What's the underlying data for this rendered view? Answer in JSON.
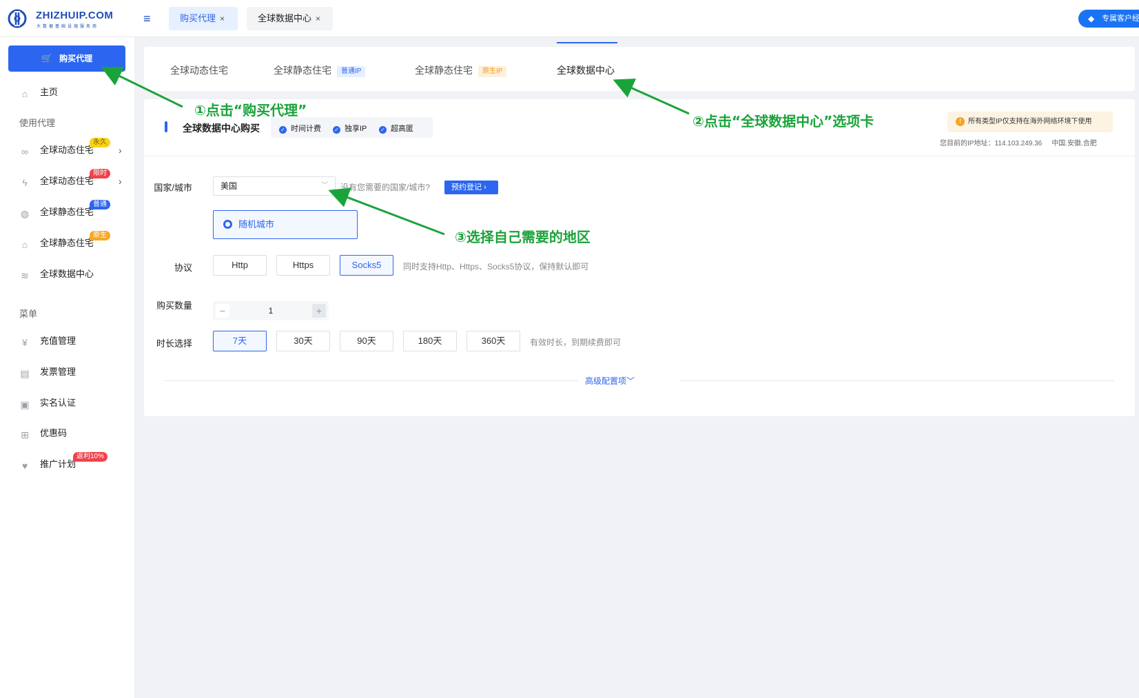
{
  "brand": {
    "name": "ZHIZHUIP.COM",
    "tagline": "大数据基础设施服务商"
  },
  "top_tabs": [
    {
      "label": "购买代理",
      "close": "×"
    },
    {
      "label": "全球数据中心",
      "close": "×"
    }
  ],
  "service_button": "专属客户经",
  "sidebar": {
    "buy_button": "购买代理",
    "home": "主页",
    "section_use": "使用代理",
    "items": [
      {
        "label": "全球动态住宅",
        "badge": "永久"
      },
      {
        "label": "全球动态住宅",
        "badge": "限时"
      },
      {
        "label": "全球静态住宅",
        "badge": "普通"
      },
      {
        "label": "全球静态住宅",
        "badge": "原生"
      },
      {
        "label": "全球数据中心",
        "badge": ""
      }
    ],
    "section_menu": "菜单",
    "menu": [
      {
        "label": "充值管理",
        "badge": ""
      },
      {
        "label": "发票管理",
        "badge": ""
      },
      {
        "label": "实名认证",
        "badge": ""
      },
      {
        "label": "优惠码",
        "badge": ""
      },
      {
        "label": "推广计划",
        "badge": "返利10%"
      }
    ]
  },
  "product_tabs": [
    {
      "label": "全球动态住宅",
      "tag": ""
    },
    {
      "label": "全球静态住宅",
      "tag": "普通IP"
    },
    {
      "label": "全球静态住宅",
      "tag": "原生IP"
    },
    {
      "label": "全球数据中心",
      "tag": ""
    }
  ],
  "purchase": {
    "title": "全球数据中心购买",
    "features": [
      "时间计费",
      "独享IP",
      "超高匿"
    ],
    "notice": "所有类型IP仅支持在海外网络环境下使用",
    "ip_label": "您目前的IP地址：114.103.249.36",
    "ip_location": "中国.安徽.合肥",
    "country_label": "国家/城市",
    "country_value": "美国",
    "country_hint": "没有您需要的国家/城市?",
    "register_button": "预约登记",
    "city_option": "随机城市",
    "protocol_label": "协议",
    "protocols": [
      "Http",
      "Https",
      "Socks5"
    ],
    "protocol_selected": "Socks5",
    "protocol_hint": "同时支持Http、Https、Socks5协议，保持默认即可",
    "quantity_label": "购买数量",
    "quantity": "1",
    "duration_label": "时长选择",
    "durations": [
      "7天",
      "30天",
      "90天",
      "180天",
      "360天"
    ],
    "duration_selected": "7天",
    "duration_hint": "有效时长，到期续费即可",
    "advanced": "高级配置项"
  },
  "annotations": [
    "①点击“购买代理”",
    "②点击“全球数据中心”选项卡",
    "③选择自己需要的地区"
  ],
  "colors": {
    "primary": "#2c66f0",
    "annotation": "#1aa33a",
    "notice_bg": "#fdf3e3"
  }
}
